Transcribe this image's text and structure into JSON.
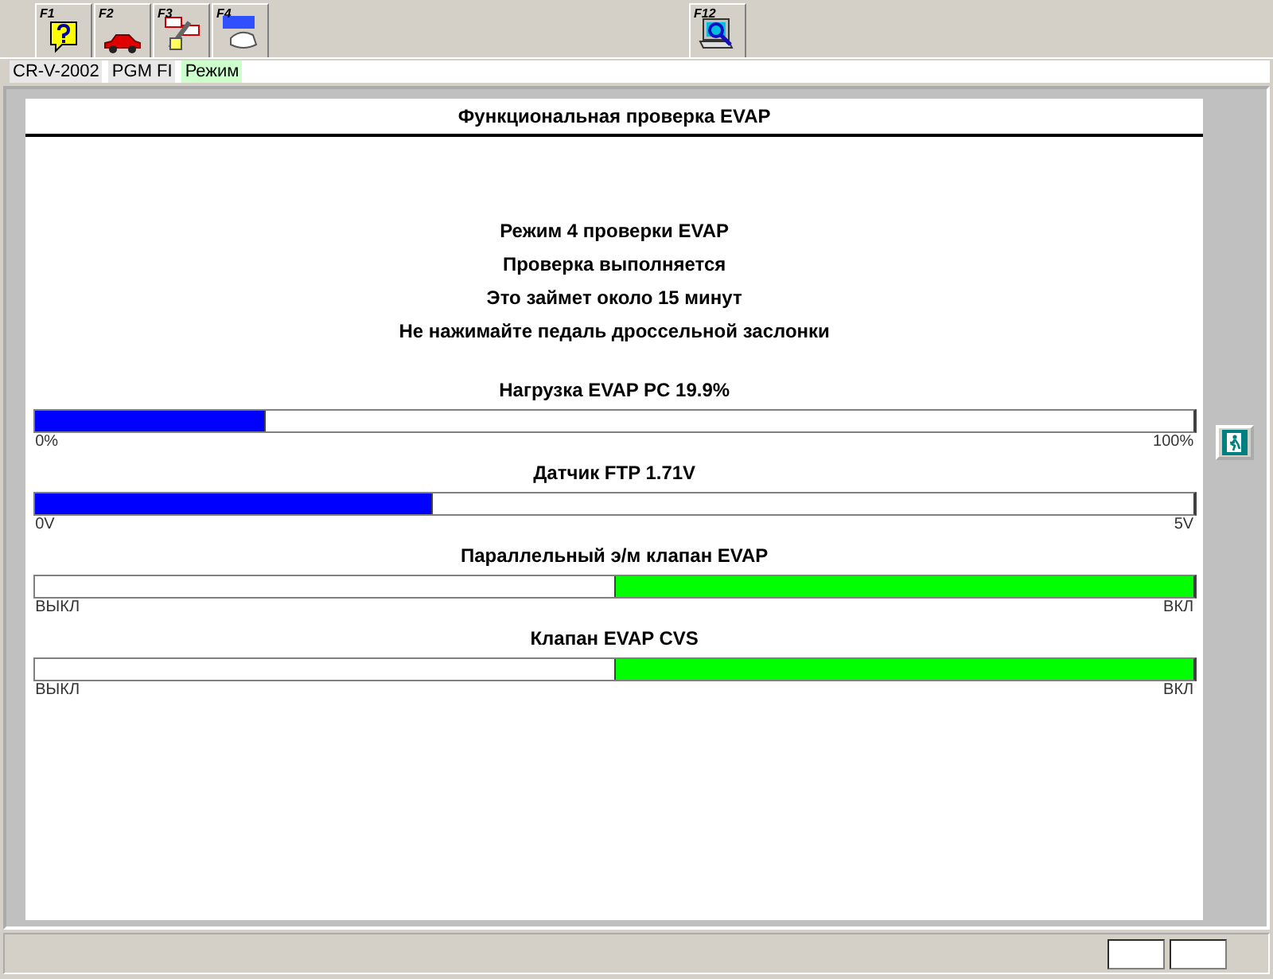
{
  "toolbar": [
    {
      "key": "F1"
    },
    {
      "key": "F2"
    },
    {
      "key": "F3"
    },
    {
      "key": "F4"
    }
  ],
  "toolbar_right": {
    "key": "F12"
  },
  "context": [
    {
      "text": "CR-V-2002",
      "highlighted": false
    },
    {
      "text": "PGM FI",
      "highlighted": false
    },
    {
      "text": "Режим",
      "highlighted": true
    }
  ],
  "panel": {
    "title": "Функциональная проверка EVAP",
    "messages": [
      "Режим 4 проверки EVAP",
      "Проверка выполняется",
      "Это займет около 15 минут",
      "Не нажимайте педаль дроссельной заслонки"
    ],
    "gauges": [
      {
        "kind": "level",
        "label": "Нагрузка EVAP PC 19.9%",
        "level": 0.199,
        "min": "0%",
        "max": "100%"
      },
      {
        "kind": "level",
        "label": "Датчик FTP 1.71V",
        "level": 0.342,
        "min": "0V",
        "max": "5V"
      },
      {
        "kind": "switch",
        "label": "Параллельный э/м клапан EVAP",
        "on": true,
        "min": "ВЫКЛ",
        "max": "ВКЛ"
      },
      {
        "kind": "switch",
        "label": "Клапан EVAP CVS",
        "on": true,
        "min": "ВЫКЛ",
        "max": "ВКЛ"
      }
    ]
  }
}
